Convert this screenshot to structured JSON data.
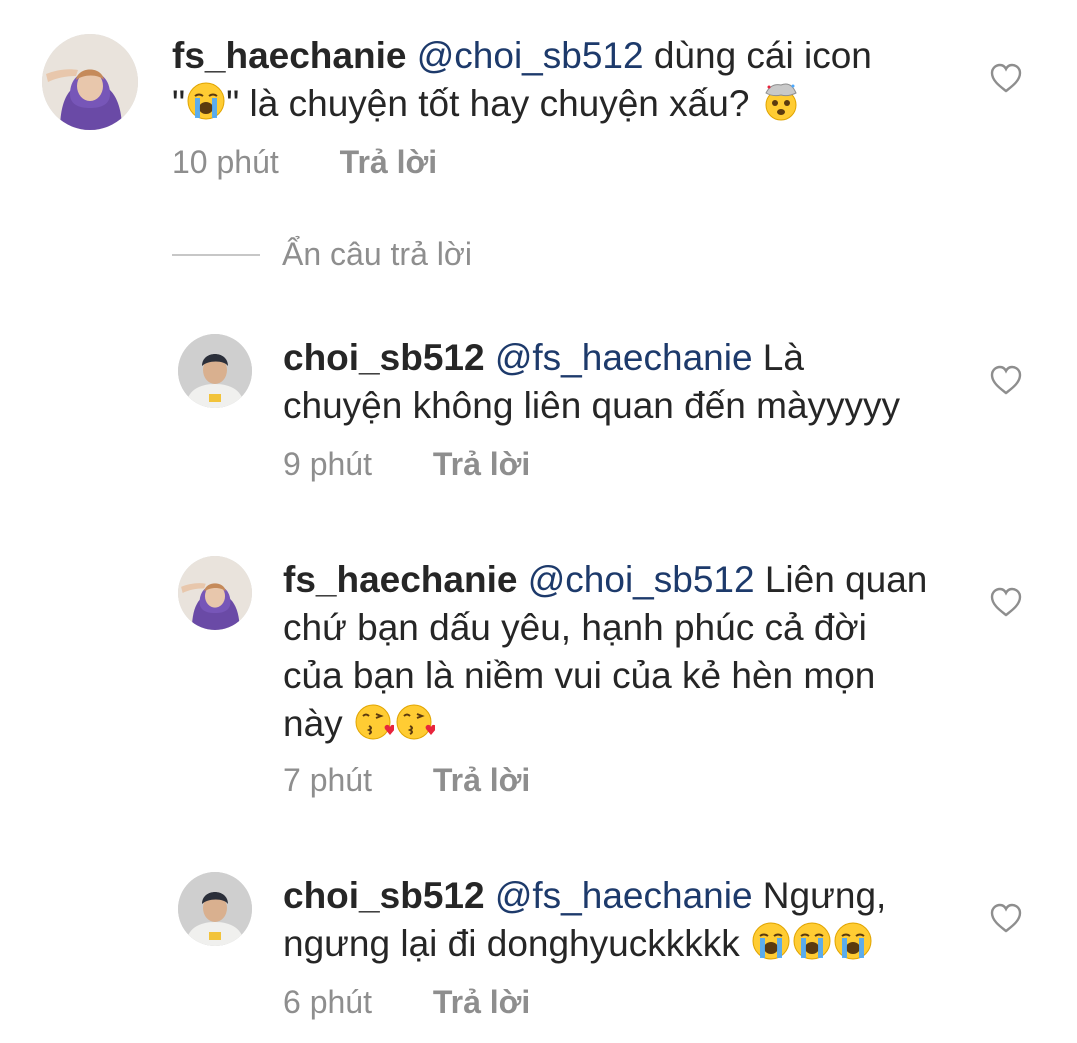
{
  "comments": [
    {
      "username": "fs_haechanie",
      "mention": "@choi_sb512",
      "text_a": " dùng cái icon",
      "text_b": "\"",
      "text_c": "\" là chuyện tốt hay chuyện xấu? ",
      "time": "10 phút",
      "reply": "Trả lời",
      "emojis": [
        "loudly-crying-face-emoji",
        "exploding-head-emoji"
      ]
    },
    {
      "username": "choi_sb512",
      "mention": "@fs_haechanie",
      "text_a": " Là",
      "text_b": "chuyện không liên quan đến màyyyyy",
      "time": "9 phút",
      "reply": "Trả lời"
    },
    {
      "username": "fs_haechanie",
      "mention": "@choi_sb512",
      "text_a": " Liên quan",
      "text_b": "chứ bạn dấu yêu, hạnh phúc cả đời",
      "text_c": "của bạn là niềm vui của kẻ hèn mọn",
      "text_d": "này ",
      "time": "7 phút",
      "reply": "Trả lời",
      "emojis": [
        "face-blowing-kiss-emoji",
        "face-blowing-kiss-emoji"
      ]
    },
    {
      "username": "choi_sb512",
      "mention": "@fs_haechanie",
      "text_a": " Ngưng,",
      "text_b": "ngưng lại đi donghyuckkkkk ",
      "time": "6 phút",
      "reply": "Trả lời",
      "emojis": [
        "loudly-crying-face-emoji",
        "loudly-crying-face-emoji",
        "loudly-crying-face-emoji"
      ]
    }
  ],
  "hide_replies": "Ẩn câu trả lời",
  "colors": {
    "text": "#262626",
    "mention": "#1d3a6b",
    "meta": "#8e8e8e",
    "divider": "#c7c7c7"
  }
}
